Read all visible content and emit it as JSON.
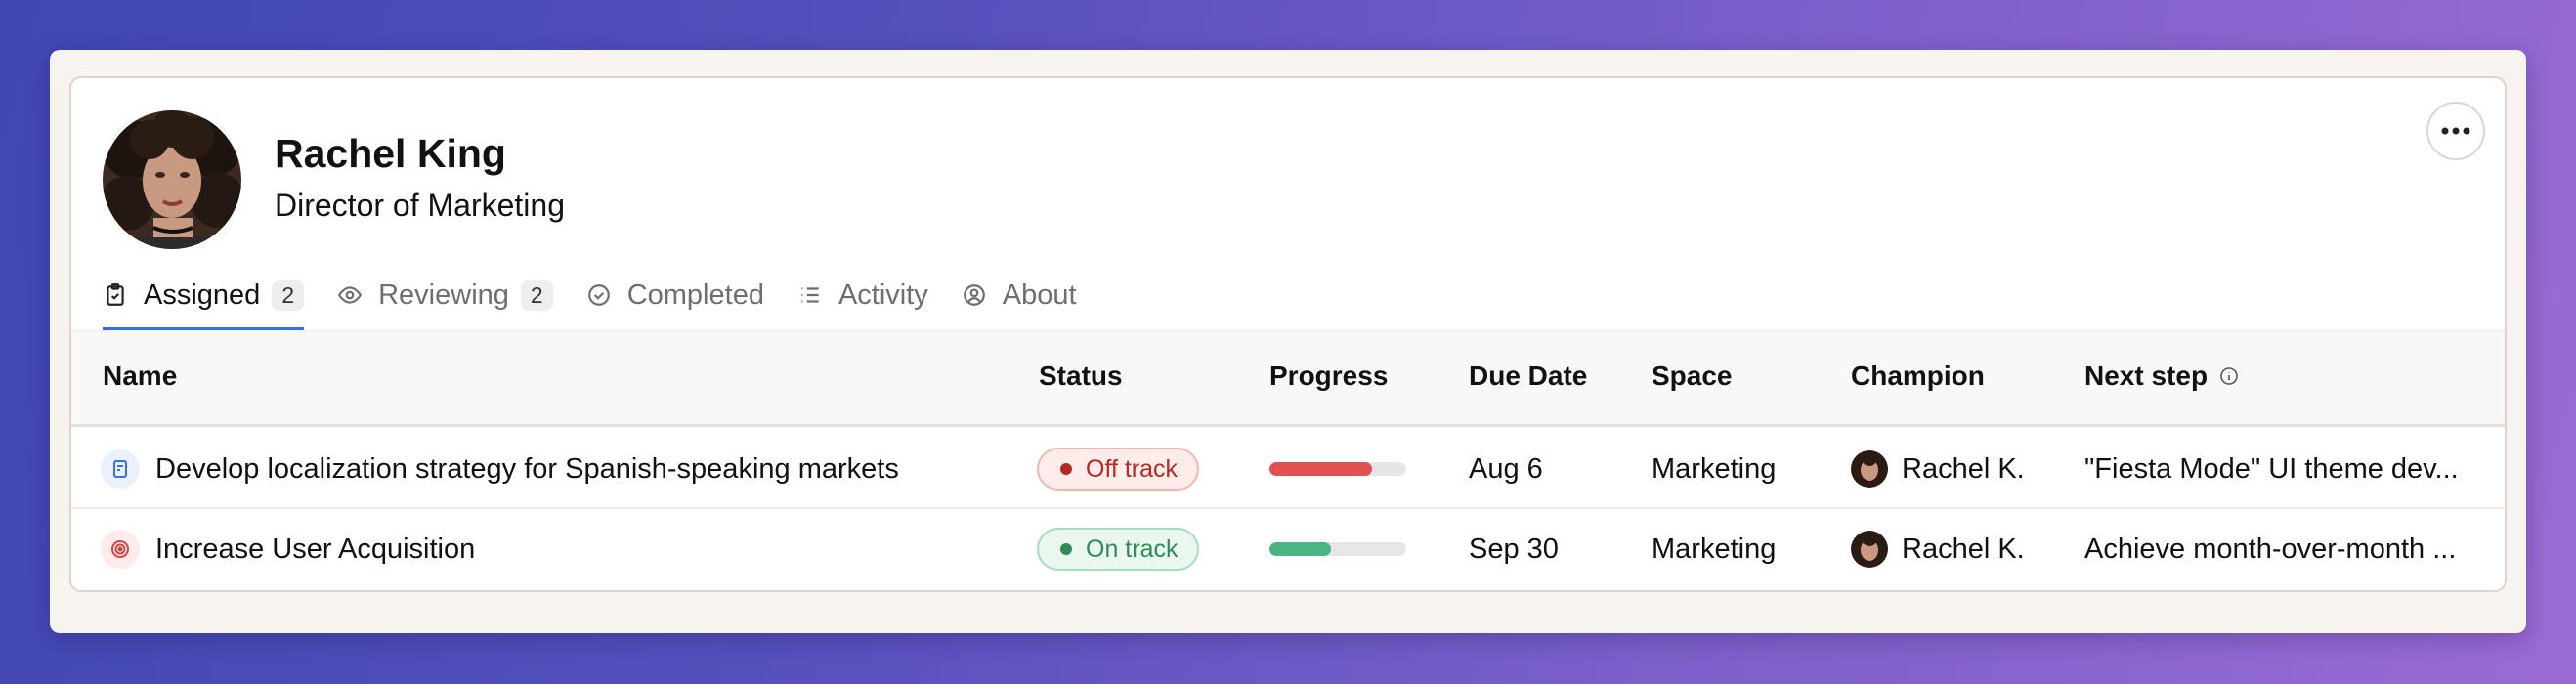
{
  "profile": {
    "name": "Rachel King",
    "title": "Director of Marketing"
  },
  "tabs": [
    {
      "label": "Assigned",
      "count": "2",
      "icon": "clipboard-icon",
      "active": true
    },
    {
      "label": "Reviewing",
      "count": "2",
      "icon": "eye-icon",
      "active": false
    },
    {
      "label": "Completed",
      "icon": "check-circle-icon",
      "active": false
    },
    {
      "label": "Activity",
      "icon": "list-icon",
      "active": false
    },
    {
      "label": "About",
      "icon": "user-circle-icon",
      "active": false
    }
  ],
  "table": {
    "headers": {
      "name": "Name",
      "status": "Status",
      "progress": "Progress",
      "due_date": "Due Date",
      "space": "Space",
      "champion": "Champion",
      "next_step": "Next step"
    },
    "rows": [
      {
        "icon": "project-icon",
        "name": "Develop localization strategy for Spanish-speaking markets",
        "status": "Off track",
        "progress": 0.75,
        "due_date": "Aug 6",
        "space": "Marketing",
        "champion": "Rachel K.",
        "next_step": "\"Fiesta Mode\" UI theme dev..."
      },
      {
        "icon": "target-icon",
        "name": "Increase User Acquisition",
        "status": "On track",
        "progress": 0.45,
        "due_date": "Sep 30",
        "space": "Marketing",
        "champion": "Rachel K.",
        "next_step": "Achieve month-over-month ..."
      }
    ]
  },
  "colors": {
    "accent": "#3b6fe0",
    "off_track": "#c0392b",
    "on_track": "#2e8b57",
    "progress_off": "#e05252",
    "progress_on": "#4cb382"
  }
}
